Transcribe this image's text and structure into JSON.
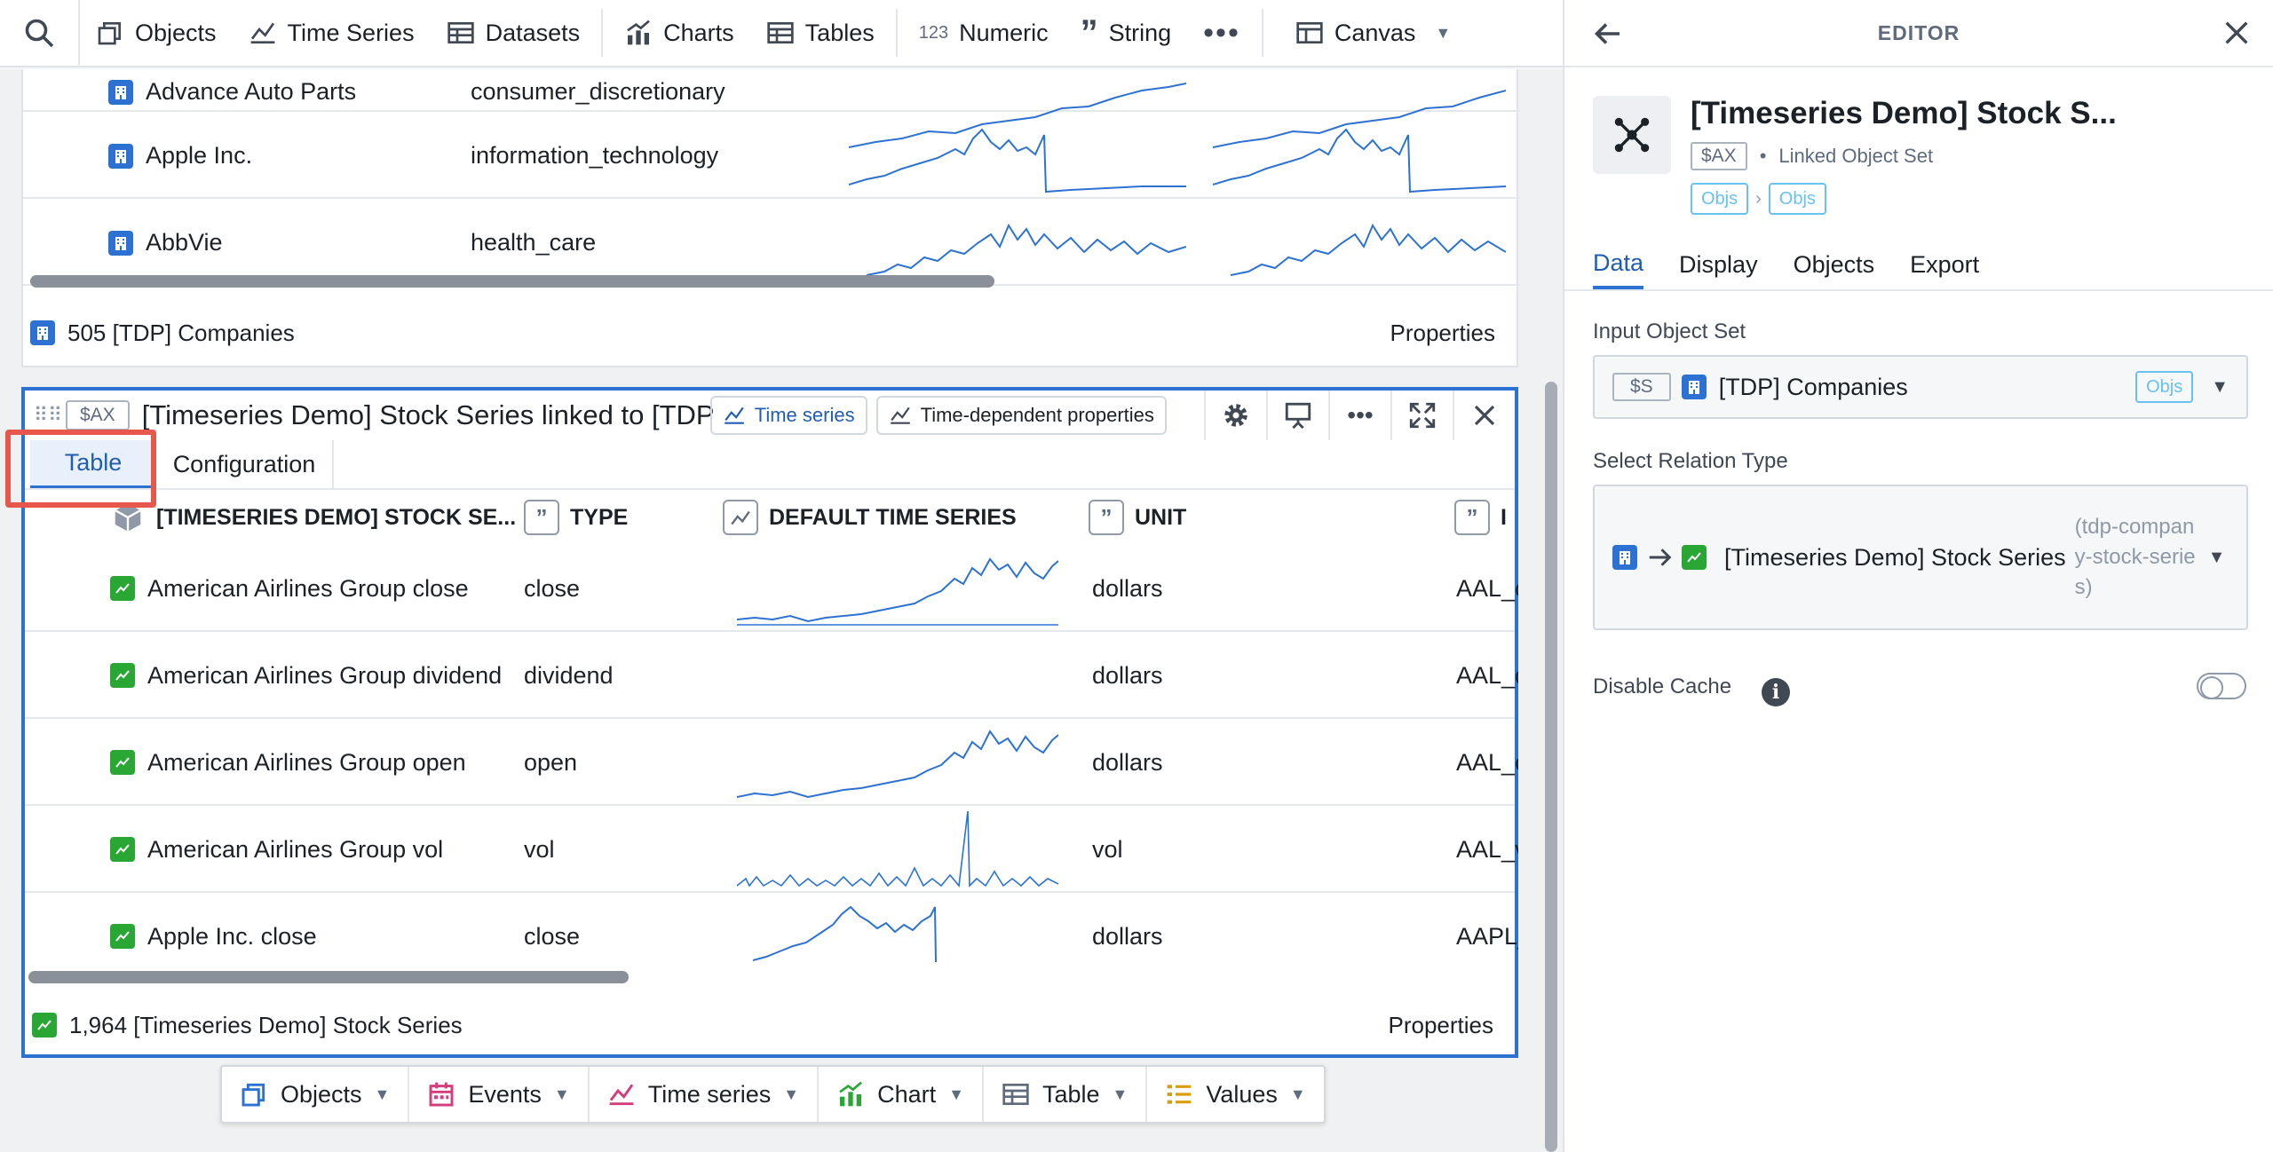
{
  "toolbar": {
    "items": [
      "Objects",
      "Time Series",
      "Datasets",
      "Charts",
      "Tables"
    ],
    "numeric_badge": "123",
    "numeric_label": "Numeric",
    "string_label": "String",
    "canvas_label": "Canvas"
  },
  "widget1": {
    "rows": [
      {
        "name": "Advance Auto Parts",
        "sector": "consumer_discretionary"
      },
      {
        "name": "Apple Inc.",
        "sector": "information_technology"
      },
      {
        "name": "AbbVie",
        "sector": "health_care"
      }
    ],
    "footer_count": "505 [TDP] Companies",
    "footer_properties": "Properties"
  },
  "widget2": {
    "var_tag": "$AX",
    "title": "[Timeseries Demo] Stock Series linked to [TDP] Companies",
    "chip_time_series": "Time series",
    "chip_time_dependent": "Time-dependent properties",
    "tab_table": "Table",
    "tab_configuration": "Configuration",
    "columns": {
      "name": "[TIMESERIES DEMO] STOCK SE...",
      "type": "TYPE",
      "default_ts": "DEFAULT TIME SERIES",
      "unit": "UNIT",
      "id": "I"
    },
    "rows": [
      {
        "name": "American Airlines Group close",
        "type": "close",
        "unit": "dollars",
        "id": "AAL_c"
      },
      {
        "name": "American Airlines Group dividend",
        "type": "dividend",
        "unit": "dollars",
        "id": "AAL_d"
      },
      {
        "name": "American Airlines Group open",
        "type": "open",
        "unit": "dollars",
        "id": "AAL_o"
      },
      {
        "name": "American Airlines Group vol",
        "type": "vol",
        "unit": "vol",
        "id": "AAL_v"
      },
      {
        "name": "Apple Inc. close",
        "type": "close",
        "unit": "dollars",
        "id": "AAPL_"
      }
    ],
    "footer_count": "1,964 [Timeseries Demo] Stock Series",
    "footer_properties": "Properties"
  },
  "bottom_bar": {
    "items": [
      "Objects",
      "Events",
      "Time series",
      "Chart",
      "Table",
      "Values"
    ]
  },
  "editor": {
    "header": "EDITOR",
    "title": "[Timeseries Demo] Stock S...",
    "var_tag": "$AX",
    "subtitle": "Linked Object Set",
    "crumb1": "Objs",
    "crumb2": "Objs",
    "tabs": [
      "Data",
      "Display",
      "Objects",
      "Export"
    ],
    "input_label": "Input Object Set",
    "input_var": "$S",
    "input_value": "[TDP] Companies",
    "input_tag": "Objs",
    "relation_label": "Select Relation Type",
    "relation_value": "[Timeseries Demo] Stock Series",
    "relation_hint": "(tdp-company-stock-series)",
    "cache_label": "Disable Cache"
  },
  "colors": {
    "accent": "#2d72d2",
    "green_icon": "#29a634",
    "highlight_box": "#e8574b",
    "sparkline": "#2d72d2"
  }
}
